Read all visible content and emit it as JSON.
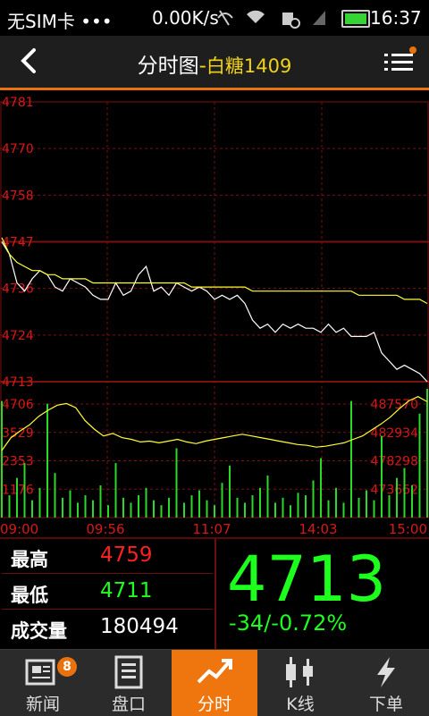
{
  "status_bar": {
    "carrier": "无SIM卡 •••",
    "net_speed": "0.00K/s",
    "time": "16:37"
  },
  "header": {
    "title_prefix": "分时图",
    "separator": "-",
    "symbol": "白糖1409"
  },
  "chart_data": {
    "type": "line",
    "price_axis": {
      "labels": [
        "4781",
        "4770",
        "4758",
        "4747",
        "4736",
        "4724",
        "4713"
      ],
      "range": [
        4713,
        4781
      ]
    },
    "volume_axis_left": {
      "labels": [
        "4706",
        "3529",
        "2353",
        "1176"
      ]
    },
    "volume_axis_right": {
      "labels": [
        "487570",
        "482934",
        "478298",
        "473662"
      ]
    },
    "x_labels": [
      "09:00",
      "09:56",
      "11:07",
      "14:03",
      "15:00"
    ],
    "series": [
      {
        "name": "",
        "color": "#ffffff",
        "values": [
          4747,
          4744,
          4737,
          4735,
          4738,
          4740,
          4739,
          4736,
          4735,
          4738,
          4737,
          4736,
          4734,
          4733,
          4733,
          4737,
          4734,
          4735,
          4739,
          4741,
          4735,
          4736,
          4734,
          4737,
          4736,
          4735,
          4736,
          4735,
          4733,
          4734,
          4733,
          4734,
          4732,
          4728,
          4726,
          4727,
          4725,
          4727,
          4726,
          4727,
          4726,
          4726,
          4725,
          4727,
          4725,
          4726,
          4724,
          4724,
          4724,
          4725,
          4720,
          4718,
          4716,
          4717,
          4716,
          4715,
          4713
        ]
      },
      {
        "name": "",
        "color": "#ffff33",
        "values": [
          4748,
          4744,
          4742,
          4741,
          4740,
          4740,
          4739,
          4739,
          4738,
          4738,
          4738,
          4738,
          4737,
          4737,
          4737,
          4737,
          4737,
          4737,
          4737,
          4737,
          4737,
          4737,
          4737,
          4737,
          4737,
          4736,
          4736,
          4736,
          4736,
          4736,
          4736,
          4736,
          4736,
          4735,
          4735,
          4735,
          4735,
          4735,
          4735,
          4735,
          4735,
          4735,
          4735,
          4735,
          4735,
          4735,
          4735,
          4734,
          4734,
          4734,
          4734,
          4734,
          4734,
          4733,
          4733,
          4733,
          4732
        ]
      }
    ],
    "open_interest": {
      "color": "#ffff33",
      "values": [
        481500,
        483000,
        483800,
        484500,
        485500,
        486200,
        486800,
        487000,
        486500,
        485000,
        484000,
        483200,
        483500,
        483000,
        482800,
        482500,
        482600,
        482400,
        482600,
        482800,
        482500,
        482300,
        482600,
        482800,
        483000,
        483200,
        483400,
        483200,
        483000,
        482800,
        482600,
        482400,
        482200,
        482100,
        481900,
        482000,
        482200,
        482400,
        482800,
        483200,
        483900,
        484600,
        485400,
        486400,
        487300,
        487800,
        487200
      ]
    },
    "volume": {
      "color": "#2ad82a",
      "bars": [
        4706,
        900,
        1600,
        2200,
        700,
        1200,
        4600,
        1800,
        800,
        1100,
        600,
        900,
        700,
        1300,
        500,
        2200,
        800,
        600,
        900,
        1200,
        700,
        500,
        800,
        2800,
        600,
        900,
        1100,
        700,
        500,
        1400,
        2100,
        800,
        600,
        900,
        1200,
        1700,
        600,
        800,
        500,
        1000,
        900,
        1500,
        2400,
        700,
        1200,
        600,
        4706,
        800,
        1100,
        700,
        3300,
        900,
        1600,
        2000,
        1300,
        4200,
        5200
      ]
    }
  },
  "info": {
    "high_label": "最高",
    "high_value": "4759",
    "high_color": "#ff2020",
    "low_label": "最低",
    "low_value": "4711",
    "low_color": "#1dff1d",
    "volume_label": "成交量",
    "volume_value": "180494",
    "last_price": "4713",
    "change": "-34/-0.72%"
  },
  "tabs": [
    {
      "label": "新闻",
      "icon": "news-icon",
      "badge": "8"
    },
    {
      "label": "盘口",
      "icon": "order-book-icon"
    },
    {
      "label": "分时",
      "icon": "timeshare-chart-icon",
      "active": true
    },
    {
      "label": "K线",
      "icon": "candlestick-icon"
    },
    {
      "label": "下单",
      "icon": "lightning-icon"
    }
  ]
}
